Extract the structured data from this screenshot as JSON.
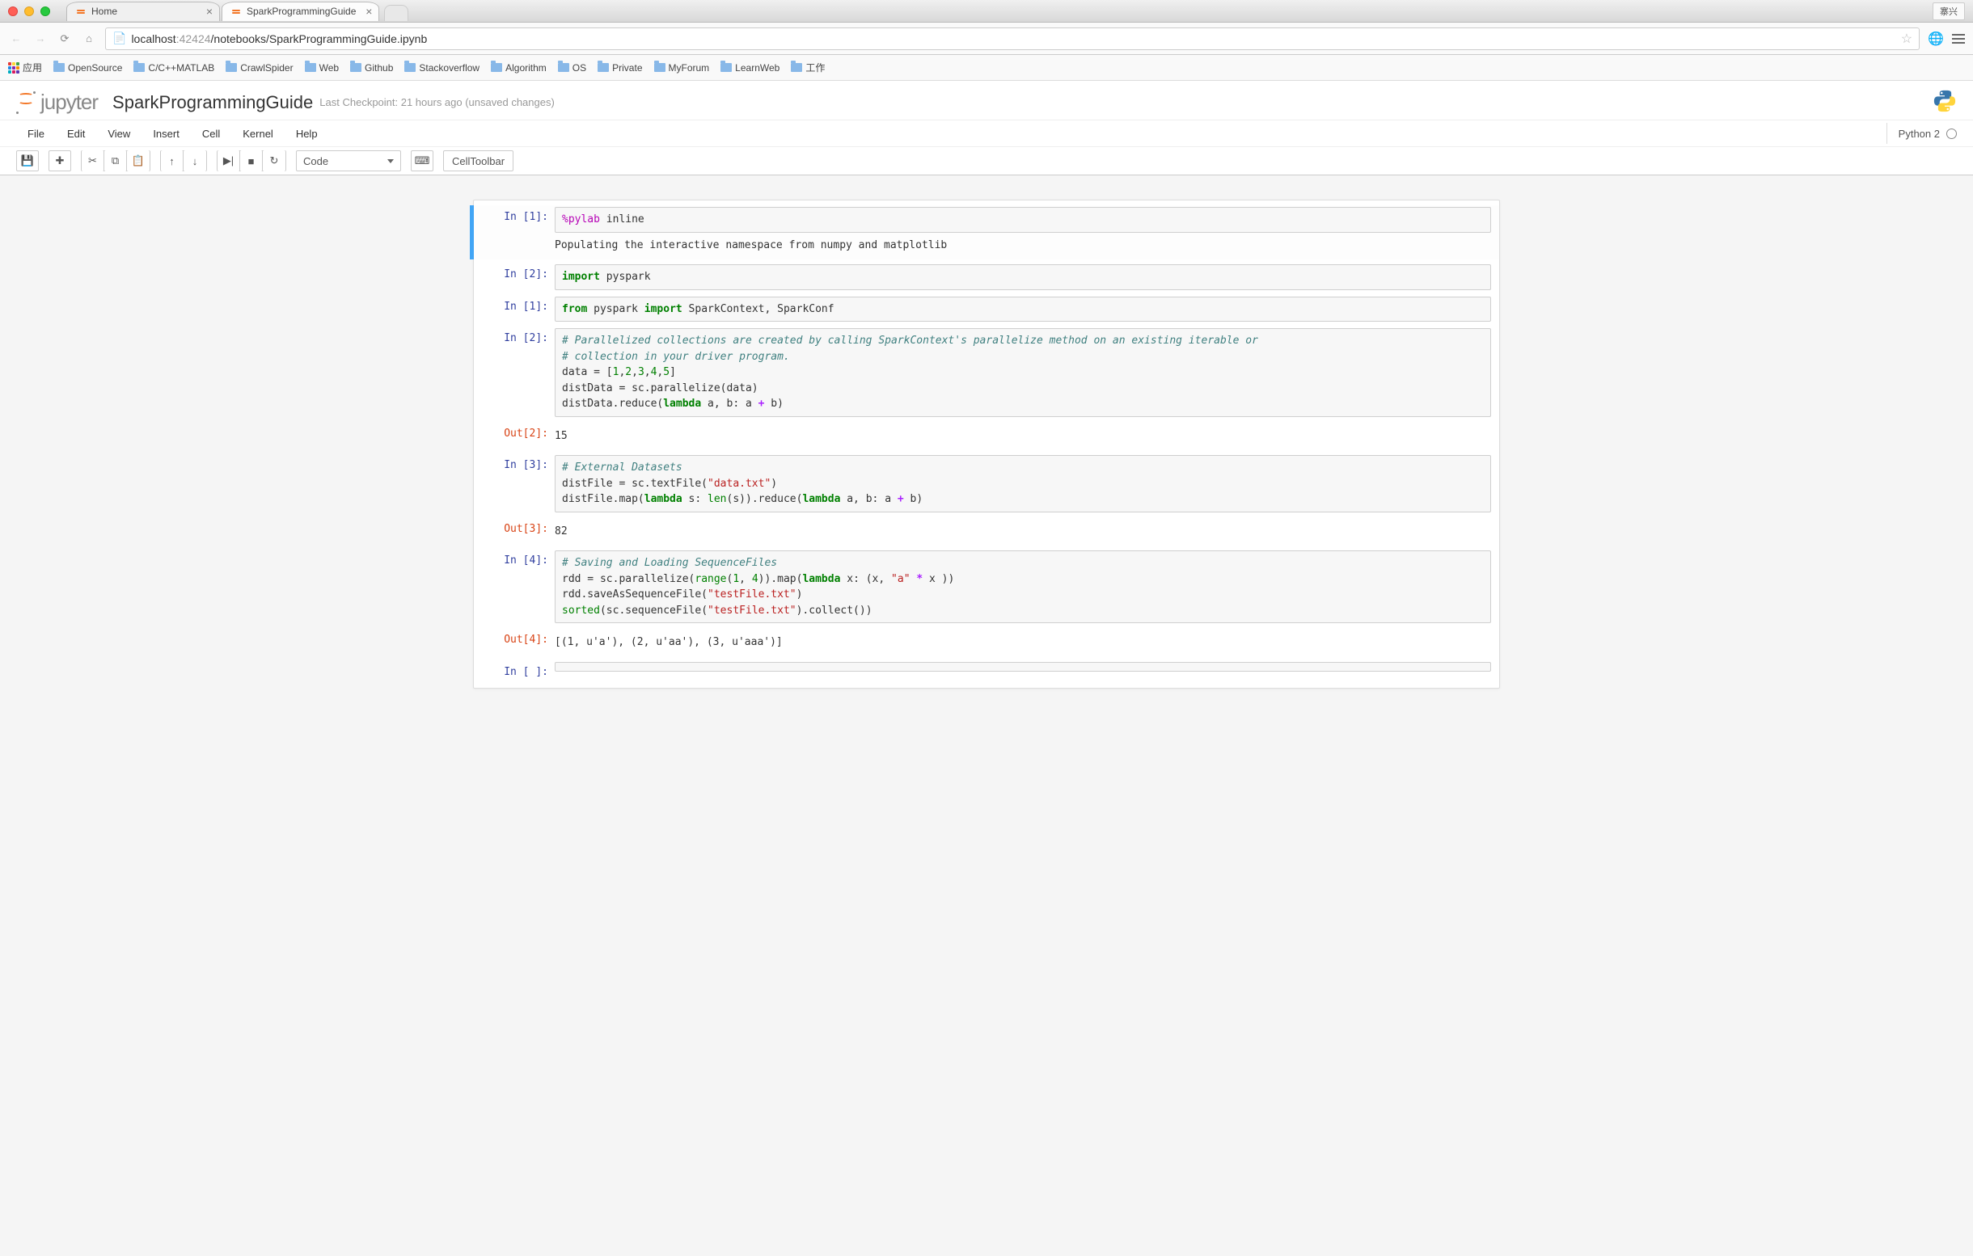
{
  "window": {
    "user": "寨兴"
  },
  "tabs": [
    {
      "label": "Home"
    },
    {
      "label": "SparkProgrammingGuide"
    }
  ],
  "url": {
    "host": "localhost",
    "port": ":42424",
    "path": "/notebooks/SparkProgrammingGuide.ipynb"
  },
  "bookmarks": {
    "apps_label": "应用",
    "items": [
      "OpenSource",
      "C/C++MATLAB",
      "CrawlSpider",
      "Web",
      "Github",
      "Stackoverflow",
      "Algorithm",
      "OS",
      "Private",
      "MyForum",
      "LearnWeb",
      "工作"
    ]
  },
  "jupyter": {
    "logo_text": "jupyter",
    "nb_title": "SparkProgrammingGuide",
    "checkpoint": "Last Checkpoint: 21 hours ago (unsaved changes)",
    "kernel": "Python 2"
  },
  "menu": [
    "File",
    "Edit",
    "View",
    "Insert",
    "Cell",
    "Kernel",
    "Help"
  ],
  "toolbar": {
    "cell_type": "Code",
    "cell_toolbar": "CellToolbar"
  },
  "cells": [
    {
      "prompt_in": "In [1]:",
      "code_html": "<span class='cm-mag'>%pylab</span> inline",
      "output": "Populating the interactive namespace from numpy and matplotlib"
    },
    {
      "prompt_in": "In [2]:",
      "code_html": "<span class='cm-kw'>import</span> pyspark"
    },
    {
      "prompt_in": "In [1]:",
      "code_html": "<span class='cm-kw'>from</span> pyspark <span class='cm-kw'>import</span> SparkContext, SparkConf"
    },
    {
      "prompt_in": "In [2]:",
      "code_html": "<span class='cm-cm'># Parallelized collections are created by calling SparkContext's parallelize method on an existing iterable or</span>\n<span class='cm-cm'># collection in your driver program.</span>\ndata = [<span class='cm-num'>1</span>,<span class='cm-num'>2</span>,<span class='cm-num'>3</span>,<span class='cm-num'>4</span>,<span class='cm-num'>5</span>]\ndistData = sc.parallelize(data)\ndistData.reduce(<span class='cm-kw'>lambda</span> a, b: a <span class='cm-op'>+</span> b)",
      "prompt_out": "Out[2]:",
      "output": "15"
    },
    {
      "prompt_in": "In [3]:",
      "code_html": "<span class='cm-cm'># External Datasets</span>\ndistFile = sc.textFile(<span class='cm-str'>\"data.txt\"</span>)\ndistFile.map(<span class='cm-kw'>lambda</span> s: <span class='cm-bi'>len</span>(s)).reduce(<span class='cm-kw'>lambda</span> a, b: a <span class='cm-op'>+</span> b)",
      "prompt_out": "Out[3]:",
      "output": "82"
    },
    {
      "prompt_in": "In [4]:",
      "code_html": "<span class='cm-cm'># Saving and Loading SequenceFiles</span>\nrdd = sc.parallelize(<span class='cm-bi'>range</span>(<span class='cm-num'>1</span>, <span class='cm-num'>4</span>)).map(<span class='cm-kw'>lambda</span> x: (x, <span class='cm-str'>\"a\"</span> <span class='cm-op'>*</span> x ))\nrdd.saveAsSequenceFile(<span class='cm-str'>\"testFile.txt\"</span>)\n<span class='cm-bi'>sorted</span>(sc.sequenceFile(<span class='cm-str'>\"testFile.txt\"</span>).collect())",
      "prompt_out": "Out[4]:",
      "output": "[(1, u'a'), (2, u'aa'), (3, u'aaa')]"
    },
    {
      "prompt_in": "In [ ]:",
      "code_html": ""
    }
  ]
}
